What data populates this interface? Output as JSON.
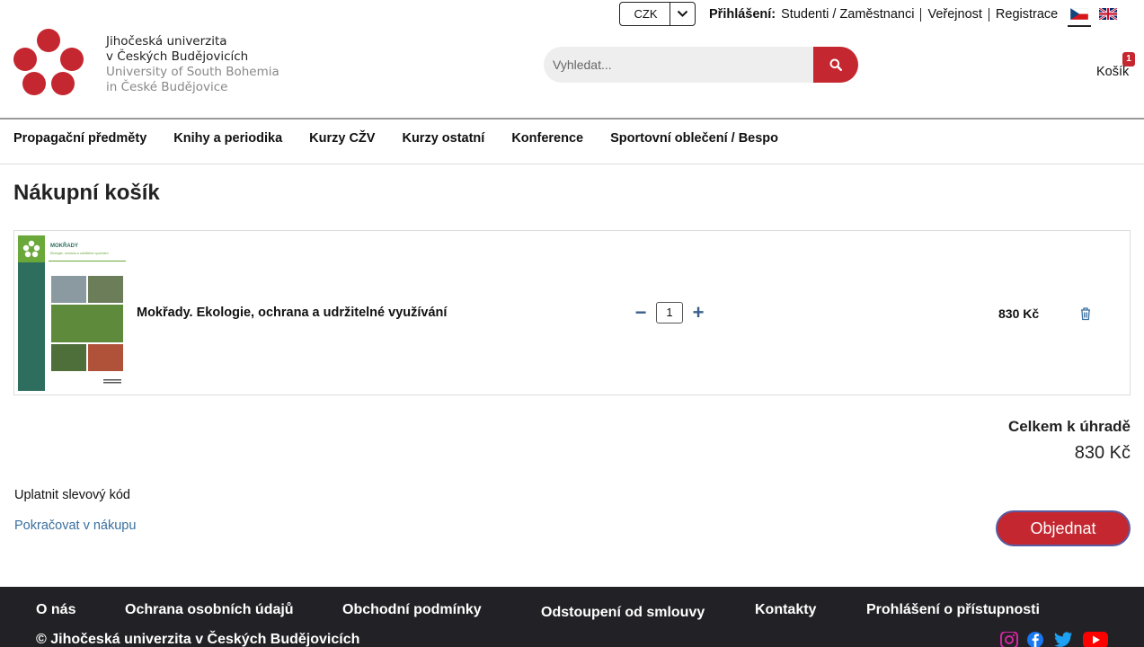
{
  "brand": {
    "name_cz_line1": "Jihočeská univerzita",
    "name_cz_line2": "v Českých Budějovicích",
    "name_en_line1": "University of South Bohemia",
    "name_en_line2": "in České Budějovice",
    "color": "#c4272f"
  },
  "currency": {
    "selected": "CZK"
  },
  "login": {
    "label": "Přihlášení:",
    "students": "Studenti / Zaměstnanci",
    "public": "Veřejnost",
    "register": "Registrace"
  },
  "languages": [
    "cz-flag-icon",
    "gb-flag-icon"
  ],
  "search": {
    "placeholder": "Vyhledat..."
  },
  "cart": {
    "count": "1",
    "label": "Košík"
  },
  "nav": {
    "items": [
      {
        "label": "Propagační předměty"
      },
      {
        "label": "Knihy a periodika"
      },
      {
        "label": "Kurzy CŽV"
      },
      {
        "label": "Kurzy ostatní"
      },
      {
        "label": "Konference"
      },
      {
        "label": "Sportovní oblečení / Bespo"
      }
    ]
  },
  "page": {
    "title": "Nákupní košík"
  },
  "cart_items": [
    {
      "name": "Mokřady. Ekologie, ochrana a udržitelné využívání",
      "quantity": "1",
      "price": "830 Kč",
      "cover_title": "MOKŘADY",
      "cover_subtitle": "Ekologie, ochrana a udržitelné využívání"
    }
  ],
  "summary": {
    "total_label": "Celkem k úhradě",
    "total_value": "830 Kč"
  },
  "actions": {
    "coupon": "Uplatnit slevový kód",
    "continue": "Pokračovat v nákupu",
    "order": "Objednat"
  },
  "footer": {
    "links": [
      {
        "label": "O nás"
      },
      {
        "label": "Ochrana osobních údajů"
      },
      {
        "label": "Obchodní podmínky"
      },
      {
        "label": "Odstoupení od smlouvy"
      },
      {
        "label": "Kontakty"
      },
      {
        "label": "Prohlášení o přístupnosti"
      }
    ],
    "copyright": "© Jihočeská univerzita v Českých Budějovicích",
    "social": [
      "instagram-icon",
      "facebook-icon",
      "twitter-icon",
      "youtube-icon"
    ]
  }
}
